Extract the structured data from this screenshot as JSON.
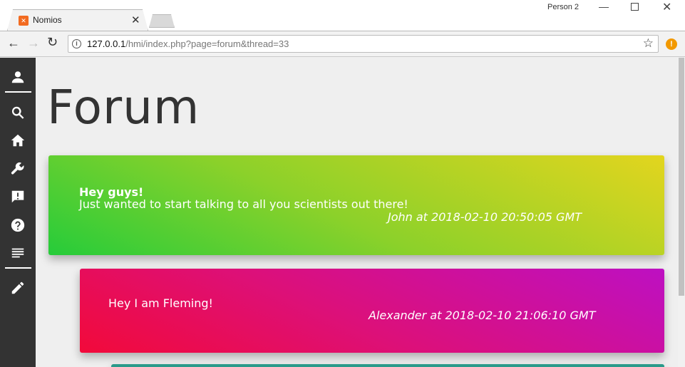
{
  "browser": {
    "tab_title": "Nomios",
    "tab_favicon": "xampp-icon",
    "profile_name": "Person 2",
    "url_host": "127.0.0.1",
    "url_path": "/hmi/index.php?page=forum&thread=33"
  },
  "sidebar": {
    "items": [
      {
        "icon": "user-icon"
      },
      {
        "icon": "search-icon"
      },
      {
        "icon": "home-icon"
      },
      {
        "icon": "wrench-icon"
      },
      {
        "icon": "feedback-icon"
      },
      {
        "icon": "help-icon"
      },
      {
        "icon": "forum-list-icon"
      },
      {
        "icon": "pencil-icon"
      }
    ]
  },
  "page": {
    "title": "Forum",
    "theme_toggle_icon": "moon-icon"
  },
  "posts": [
    {
      "title": "Hey guys!",
      "body": "Just wanted to start talking to all you scientists out there!",
      "meta": "John at 2018-02-10 20:50:05 GMT",
      "colors": [
        "#26cc3a",
        "#e3d51e"
      ]
    },
    {
      "title": "",
      "body": "Hey I am Fleming!",
      "meta": "Alexander at 2018-02-10 21:06:10 GMT",
      "colors": [
        "#f20a3a",
        "#bd10c2"
      ]
    }
  ]
}
